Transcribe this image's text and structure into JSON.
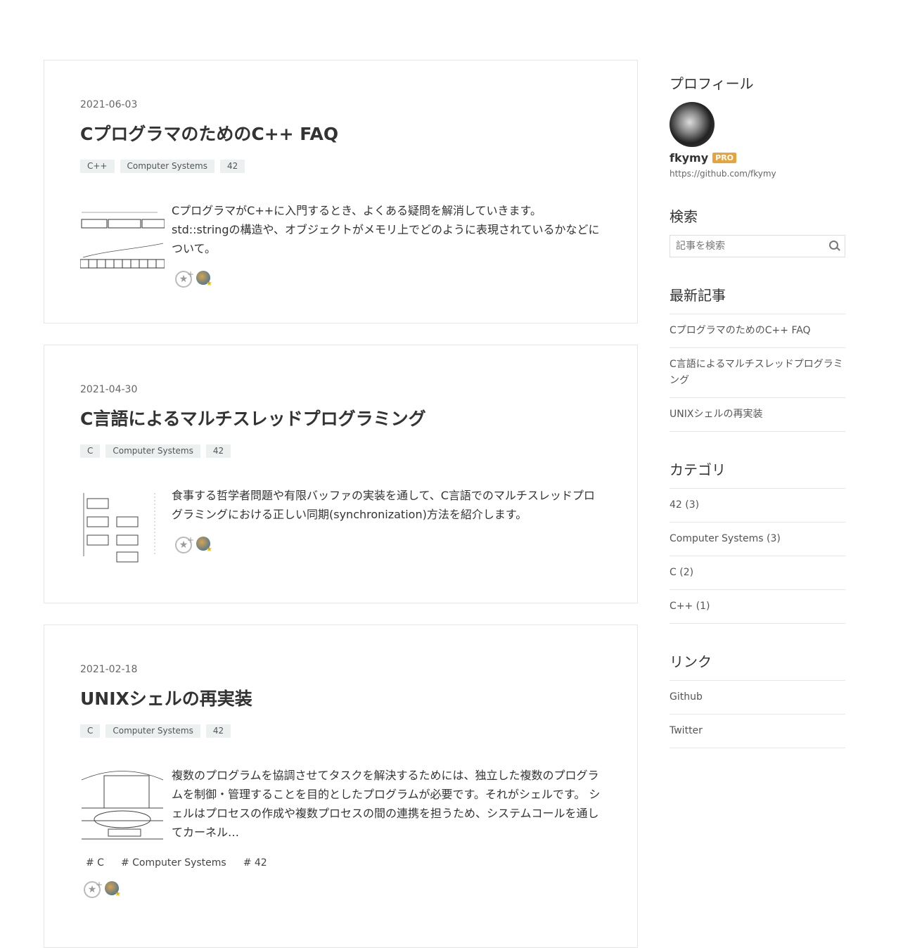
{
  "posts": [
    {
      "date": "2021-06-03",
      "title": "CプログラマのためのC++ FAQ",
      "tags": [
        "C++",
        "Computer Systems",
        "42"
      ],
      "summary": "CプログラマがC++に入門するとき、よくある疑問を解消していきます。 std::stringの構造や、オブジェクトがメモリ上でどのように表現されているかなどについて。"
    },
    {
      "date": "2021-04-30",
      "title": "C言語によるマルチスレッドプログラミング",
      "tags": [
        "C",
        "Computer Systems",
        "42"
      ],
      "summary": "食事する哲学者問題や有限バッファの実装を通して、C言語でのマルチスレッドプログラミングにおける正しい同期(synchronization)方法を紹介します。"
    },
    {
      "date": "2021-02-18",
      "title": "UNIXシェルの再実装",
      "tags": [
        "C",
        "Computer Systems",
        "42"
      ],
      "summary": "複数のプログラムを協調させてタスクを解決するためには、独立した複数のプログラムを制御・管理することを目的としたプログラムが必要です。それがシェルです。 シェルはプロセスの作成や複数プロセスの間の連携を担うため、システムコールを通してカーネル…",
      "hashtags": [
        "# C",
        "# Computer Systems",
        "# 42"
      ]
    }
  ],
  "sidebar": {
    "profile": {
      "heading": "プロフィール",
      "name": "fkymy",
      "badge": "PRO",
      "url": "https://github.com/fkymy"
    },
    "search": {
      "heading": "検索",
      "placeholder": "記事を検索"
    },
    "recent": {
      "heading": "最新記事",
      "items": [
        "CプログラマのためのC++ FAQ",
        "C言語によるマルチスレッドプログラミング",
        "UNIXシェルの再実装"
      ]
    },
    "categories": {
      "heading": "カテゴリ",
      "items": [
        "42 (3)",
        "Computer Systems (3)",
        "C (2)",
        "C++ (1)"
      ]
    },
    "links": {
      "heading": "リンク",
      "items": [
        "Github",
        "Twitter"
      ]
    }
  },
  "icons": {
    "star": "star-add-icon",
    "search": "search-icon"
  }
}
